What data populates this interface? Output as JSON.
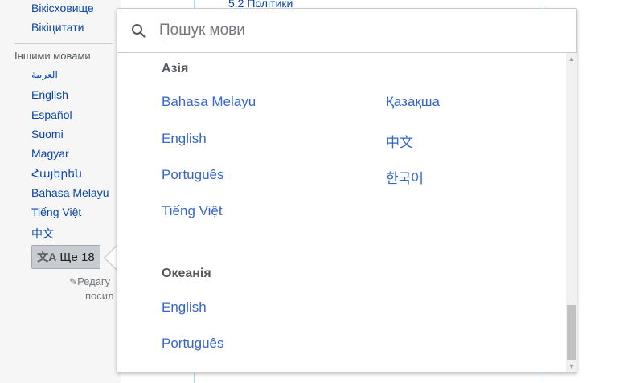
{
  "sidebar": {
    "top_links": [
      "Вікісховище",
      "Вікіцитати"
    ],
    "languages_heading": "Іншими мовами",
    "languages": [
      "العربية",
      "English",
      "Español",
      "Suomi",
      "Magyar",
      "Հայերեն",
      "Bahasa Melayu",
      "Tiếng Việt",
      "中文"
    ],
    "more_button_label": "Ще 18",
    "edit_links_line1": "Редагу",
    "edit_links_line2": "посил"
  },
  "content": {
    "toc_item": "5.2 Політики"
  },
  "language_selector": {
    "search_placeholder": "Пошук мови",
    "regions": [
      {
        "title": "Азія",
        "languages": [
          "Bahasa Melayu",
          "Қазақша",
          "English",
          "中文",
          "Português",
          "한국어",
          "Tiếng Việt"
        ]
      },
      {
        "title": "Океанія",
        "languages": [
          "English",
          "Português"
        ]
      }
    ]
  },
  "icons": {
    "search": "search-icon",
    "translate": "translate-icon",
    "pencil": "pencil-icon"
  },
  "colors": {
    "link": "#3366cc",
    "sidebar_link": "#0645ad",
    "region_title": "#54595d",
    "sidebar_bg": "#f6f6f6"
  }
}
